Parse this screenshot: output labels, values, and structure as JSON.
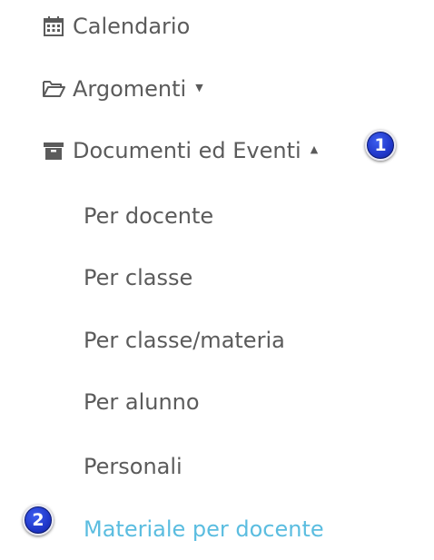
{
  "menu": {
    "calendario": {
      "label": "Calendario",
      "icon": "calendar-icon"
    },
    "argomenti": {
      "label": "Argomenti",
      "icon": "folder-open-icon",
      "caret": "▼"
    },
    "documenti": {
      "label": "Documenti ed Eventi",
      "icon": "archive-icon",
      "caret": "▲"
    },
    "submenu": [
      {
        "label": "Per docente"
      },
      {
        "label": "Per classe"
      },
      {
        "label": "Per classe/materia"
      },
      {
        "label": "Per alunno"
      },
      {
        "label": "Personali"
      },
      {
        "label": "Materiale per docente",
        "active": true
      }
    ]
  },
  "badges": {
    "first": "1",
    "second": "2"
  },
  "colors": {
    "text": "#5b5b5b",
    "active_link": "#5bbde0",
    "badge": "#1f36c8"
  }
}
